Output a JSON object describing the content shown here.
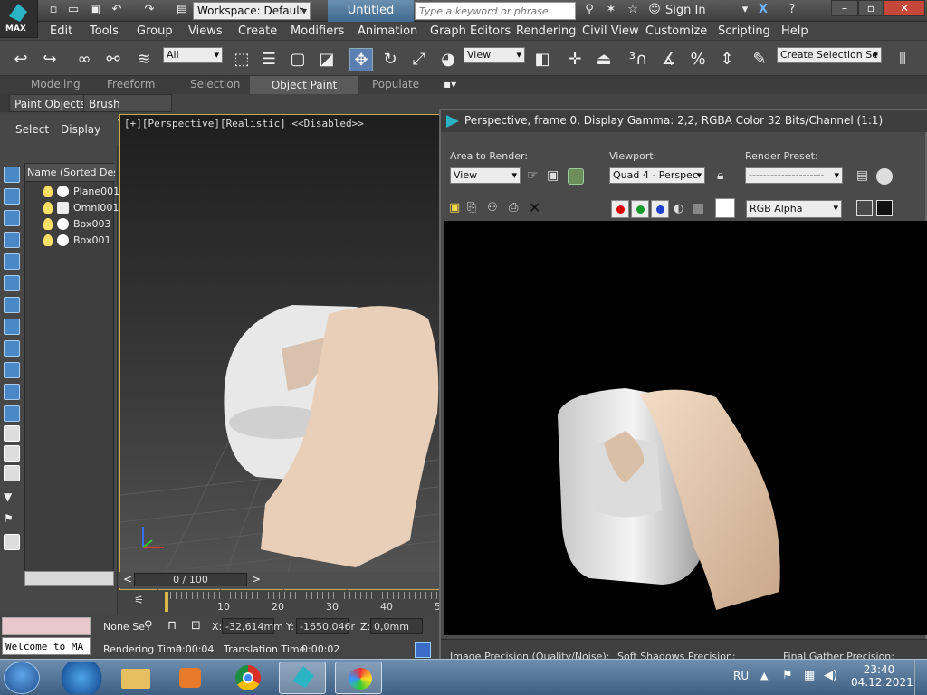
{
  "titlebar": {
    "workspace": "Workspace: Default",
    "doc_title": "Untitled",
    "search_placeholder": "Type a keyword or phrase",
    "sign_in": "Sign In",
    "logo_text": "MAX"
  },
  "menu": [
    "Edit",
    "Tools",
    "Group",
    "Views",
    "Create",
    "Modifiers",
    "Animation",
    "Graph Editors",
    "Rendering",
    "Civil View",
    "Customize",
    "Scripting",
    "Help"
  ],
  "toolbar": {
    "filter": "All",
    "ref_coord": "View",
    "named_sel": "Create Selection Se"
  },
  "ribbon": {
    "tabs": [
      "Modeling",
      "Freeform",
      "Selection",
      "Object Paint",
      "Populate"
    ],
    "active_tab": "Object Paint",
    "subtabs": [
      "Paint Objects",
      "Brush Settings"
    ]
  },
  "scene_explorer": {
    "tabs": [
      "Select",
      "Display"
    ],
    "column_header": "Name (Sorted Desce",
    "items": [
      "Plane001",
      "Omni001",
      "Box003",
      "Box001"
    ]
  },
  "viewport": {
    "label": "[+][Perspective][Realistic] <<Disabled>>",
    "time_slider": "0 / 100",
    "ruler": [
      "10",
      "20",
      "30",
      "40",
      "5"
    ]
  },
  "status": {
    "selection": "None Se",
    "x_label": "X:",
    "x_value": "-32,614mm",
    "y_label": "Y:",
    "y_value": "-1650,046r",
    "z_label": "Z:",
    "z_value": "0,0mm",
    "welcome": "Welcome to MA",
    "render_time_label": "Rendering Time",
    "render_time": "0:00:04",
    "translation_label": "Translation Time",
    "translation_time": "0:00:02"
  },
  "render_window": {
    "title": "Perspective, frame 0, Display Gamma: 2,2, RGBA Color 32 Bits/Channel (1:1)",
    "area_label": "Area to Render:",
    "area_value": "View",
    "viewport_label": "Viewport:",
    "viewport_value": "Quad 4 - Perspec",
    "preset_label": "Render Preset:",
    "preset_value": "---------------------",
    "channel": "RGB Alpha",
    "footer": [
      "Image Precision (Quality/Noise):",
      "Soft Shadows Precision:",
      "Final Gather Precision:"
    ]
  },
  "taskbar": {
    "lang": "RU",
    "time": "23:40",
    "date": "04.12.2021"
  },
  "colors": {
    "accent": "#5a7fb0",
    "viewport_border": "#c9a94a",
    "cloth": "#e9cfb8"
  }
}
